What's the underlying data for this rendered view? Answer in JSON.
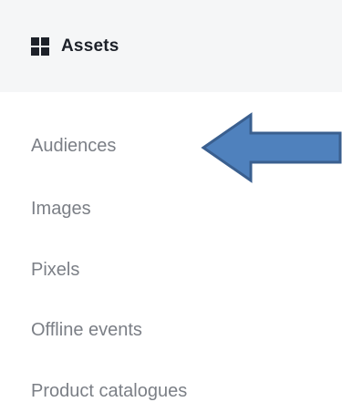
{
  "header": {
    "title": "Assets",
    "icon": "grid-icon"
  },
  "menu": {
    "items": [
      {
        "label": "Audiences"
      },
      {
        "label": "Images"
      },
      {
        "label": "Pixels"
      },
      {
        "label": "Offline events"
      },
      {
        "label": "Product catalogues"
      }
    ]
  },
  "annotation": {
    "icon": "arrow-left-icon",
    "fill_color": "#4f81bd",
    "stroke_color": "#3a5f8f"
  },
  "colors": {
    "header_background": "#f5f6f7",
    "menu_text": "#7b7f86",
    "header_text": "#1d2129"
  }
}
